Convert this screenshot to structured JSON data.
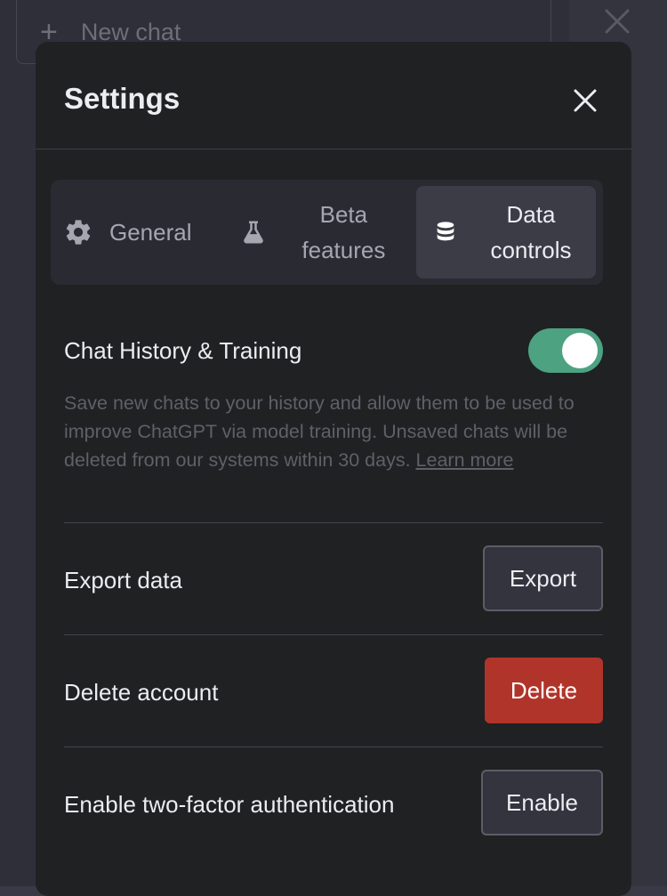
{
  "background": {
    "new_chat_label": "New chat"
  },
  "modal": {
    "title": "Settings",
    "tabs": [
      {
        "label": "General",
        "icon": "gear-icon",
        "selected": false
      },
      {
        "label": "Beta features",
        "icon": "flask-icon",
        "selected": false
      },
      {
        "label": "Data controls",
        "icon": "database-icon",
        "selected": true
      }
    ],
    "chat_history": {
      "title": "Chat History & Training",
      "enabled": true,
      "description": "Save new chats to your history and allow them to be used to improve ChatGPT via model training. Unsaved chats will be deleted from our systems within 30 days.",
      "learn_more": "Learn more"
    },
    "export": {
      "title": "Export data",
      "button": "Export"
    },
    "delete": {
      "title": "Delete account",
      "button": "Delete"
    },
    "two_factor": {
      "title": "Enable two-factor authentication",
      "button": "Enable"
    }
  },
  "colors": {
    "toggle_on": "#4ca281",
    "danger": "#b1342a",
    "modal_bg": "#202123"
  }
}
